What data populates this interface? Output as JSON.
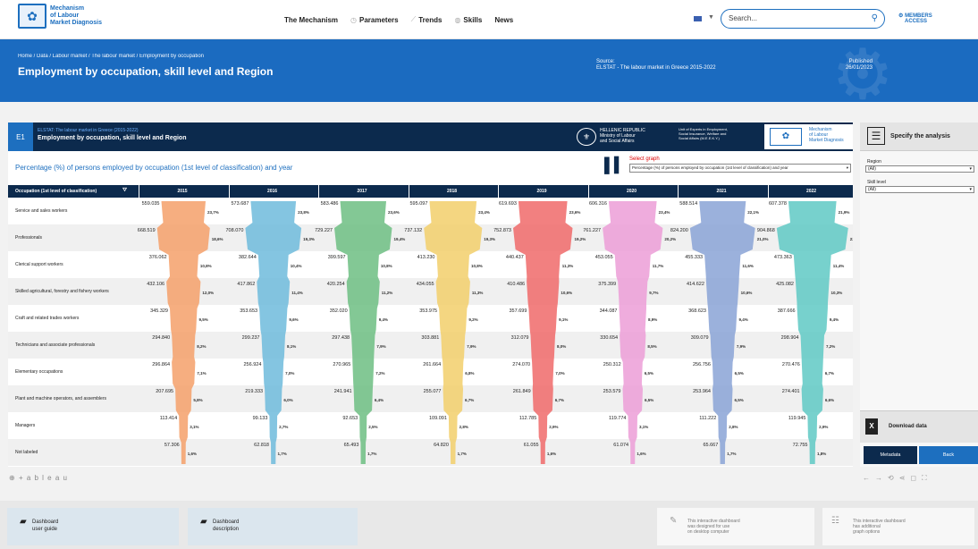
{
  "site": {
    "logo_line1": "Mechanism",
    "logo_line2": "of Labour",
    "logo_line3": "Market Diagnosis",
    "nav": [
      "The Mechanism",
      "Parameters",
      "Trends",
      "Skills",
      "News"
    ],
    "search_placeholder": "Search...",
    "members_line1": "MEMBERS",
    "members_line2": "ACCESS"
  },
  "hero": {
    "breadcrumb": "Home / Data / Labour market / The labour market / Employment by occupation",
    "title": "Employment by occupation, skill level and Region",
    "source_label": "Source:",
    "source_value": "ELSTAT - The labour market in Greece 2015-2022",
    "published_label": "Published",
    "published_value": "26/01/2023"
  },
  "dashboard": {
    "code": "E1",
    "subtitle": "ELSTAT: The labour market in Greece (2015-2022)",
    "title": "Employment by occupation, skill level and Region",
    "ministry_line1": "HELLENIC REPUBLIC",
    "ministry_line2": "Ministry of Labour",
    "ministry_line3": "and Social Affairs",
    "unit_line1": "Unit of Experts in Employment,",
    "unit_line2": "Social Insurance, Welfare and",
    "unit_line3": "Social Affairs (M.E.E.K.Y.)",
    "mech_line1": "Mechanism",
    "mech_line2": "of Labour",
    "mech_line3": "Market Diagnosis",
    "chart_title": "Percentage (%) of persons employed by occupation (1st level of classification) and year",
    "select_graph_label": "Select graph",
    "select_graph_value": "Percentage (%) of persons employed by occupation (1st level of classification) and year",
    "occupation_header": "Occupation (1st level of classification)"
  },
  "chart_data": {
    "type": "bar",
    "years": [
      "2015",
      "2016",
      "2017",
      "2018",
      "2019",
      "2020",
      "2021",
      "2022"
    ],
    "occupations": [
      "Service and sales workers",
      "Professionals",
      "Clerical support workers",
      "Skilled agricultural, forestry and fishery workers",
      "Craft and related trades workers",
      "Technicians and associate professionals",
      "Elementary occupations",
      "Plant and machine operators, and assemblers",
      "Managers",
      "Not labeled"
    ],
    "colors": [
      "#f4a06a",
      "#6fbbdc",
      "#6dbe83",
      "#f2cf6b",
      "#f06a6a",
      "#ec9ed7",
      "#8aa3d6",
      "#5fc9c4"
    ],
    "values": [
      [
        559.035,
        573.687,
        583.486,
        595.097,
        619.693,
        606.316,
        588.514,
        607.378
      ],
      [
        668.519,
        708.07,
        729.227,
        737.132,
        752.873,
        761.227,
        824.2,
        904.868
      ],
      [
        376.062,
        382.644,
        399.597,
        413.23,
        440.437,
        453.055,
        455.333,
        473.363
      ],
      [
        432.106,
        417.862,
        420.254,
        434.055,
        410.486,
        375.399,
        414.622,
        425.082
      ],
      [
        345.329,
        353.653,
        352.02,
        353.975,
        357.699,
        344.087,
        368.623,
        387.666
      ],
      [
        294.84,
        299.237,
        297.438,
        303.881,
        312.079,
        330.654,
        309.079,
        298.904
      ],
      [
        296.864,
        256.924,
        270.965,
        261.664,
        274.07,
        250.312,
        256.756,
        270.476
      ],
      [
        207.695,
        219.333,
        241.941,
        255.077,
        261.849,
        253.579,
        253.964,
        274.401
      ],
      [
        113.414,
        99.133,
        92.653,
        109.091,
        112.785,
        119.774,
        111.222,
        119.945
      ],
      [
        57.306,
        62.818,
        65.493,
        64.82,
        61.055,
        61.074,
        65.667,
        72.755
      ]
    ],
    "percents": [
      [
        "23,7%",
        "23,8%",
        "23,6%",
        "23,4%",
        "23,6%",
        "23,4%",
        "22,1%",
        "21,9%"
      ],
      [
        "18,6%",
        "19,3%",
        "19,4%",
        "19,3%",
        "19,2%",
        "20,2%",
        "21,0%",
        "23,3%"
      ],
      [
        "10,8%",
        "10,4%",
        "10,8%",
        "10,8%",
        "11,3%",
        "11,7%",
        "11,6%",
        "11,4%"
      ],
      [
        "12,0%",
        "11,4%",
        "11,2%",
        "11,3%",
        "10,6%",
        "9,7%",
        "10,6%",
        "10,3%"
      ],
      [
        "9,5%",
        "9,6%",
        "9,4%",
        "9,2%",
        "9,1%",
        "8,9%",
        "9,4%",
        "9,4%"
      ],
      [
        "8,2%",
        "8,1%",
        "7,9%",
        "7,9%",
        "8,0%",
        "8,5%",
        "7,9%",
        "7,2%"
      ],
      [
        "7,1%",
        "7,0%",
        "7,2%",
        "6,8%",
        "7,0%",
        "6,5%",
        "6,5%",
        "6,7%"
      ],
      [
        "5,8%",
        "6,0%",
        "6,4%",
        "6,7%",
        "6,7%",
        "6,5%",
        "6,5%",
        "6,6%"
      ],
      [
        "3,1%",
        "2,7%",
        "2,5%",
        "2,8%",
        "2,9%",
        "3,1%",
        "2,8%",
        "2,9%"
      ],
      [
        "1,6%",
        "1,7%",
        "1,7%",
        "1,7%",
        "1,6%",
        "1,6%",
        "1,7%",
        "1,8%"
      ]
    ]
  },
  "sidebar": {
    "specify": "Specify the analysis",
    "region_label": "Region",
    "region_value": "(All)",
    "skill_label": "Skill level",
    "skill_value": "(All)",
    "download": "Download data",
    "metadata": "Metadata",
    "back": "Back"
  },
  "footer": {
    "tableau": "+ a b l e a u",
    "guide_line1": "Dashboard",
    "guide_line2": "user guide",
    "desc_line1": "Dashboard",
    "desc_line2": "description",
    "desktop_line1": "This interactive dashboard",
    "desktop_line2": "was designed for use",
    "desktop_line3": "on desktop computer",
    "options_line1": "This interactive dashboard",
    "options_line2": "has additional",
    "options_line3": "graph options"
  }
}
